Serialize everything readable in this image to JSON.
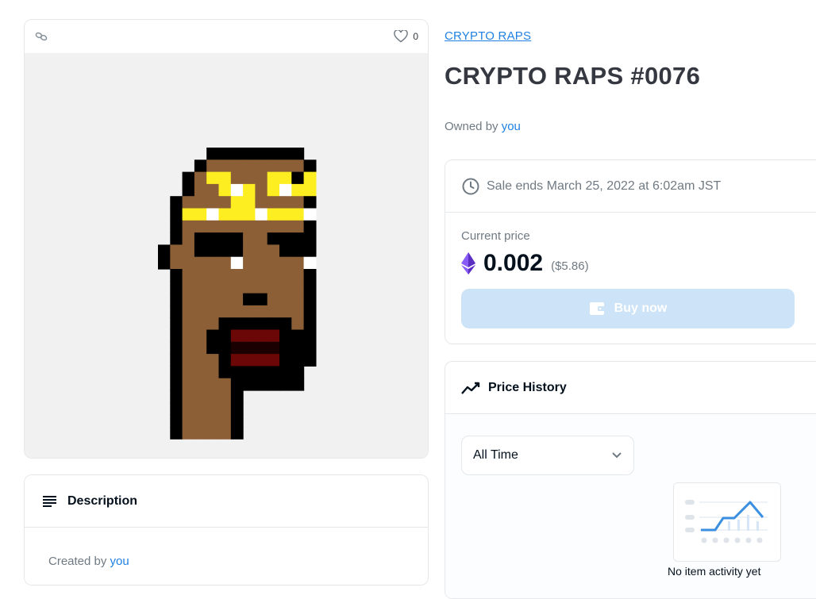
{
  "image_card": {
    "favorites_count": "0",
    "icons": {
      "chain": "chain-link-icon",
      "favorite": "heart-icon"
    }
  },
  "nft_art": {
    "palette": {
      "bg": "#f1f1f1",
      "black": "#000000",
      "skin": "#8c5f37",
      "gold": "#fcee21",
      "white": "#ffffff",
      "lips": "#6b0707",
      "lipline": "#1a0000"
    }
  },
  "description": {
    "header": "Description",
    "created_by_prefix": "Created by",
    "creator": "you"
  },
  "collection": {
    "name": "CRYPTO RAPS"
  },
  "item": {
    "title": "CRYPTO RAPS #0076"
  },
  "owner": {
    "prefix": "Owned by",
    "name": "you"
  },
  "sale": {
    "ends_text": "Sale ends March 25, 2022 at 6:02am JST",
    "current_price_label": "Current price",
    "price": "0.002",
    "price_usd": "($5.86)",
    "buy_button": "Buy now"
  },
  "price_history": {
    "header": "Price History",
    "range_selected": "All Time",
    "empty_text": "No item activity yet"
  },
  "colors": {
    "accent": "#2081e2",
    "buy_disabled": "#cde3f7",
    "muted": "#707a83",
    "title": "#353840"
  }
}
